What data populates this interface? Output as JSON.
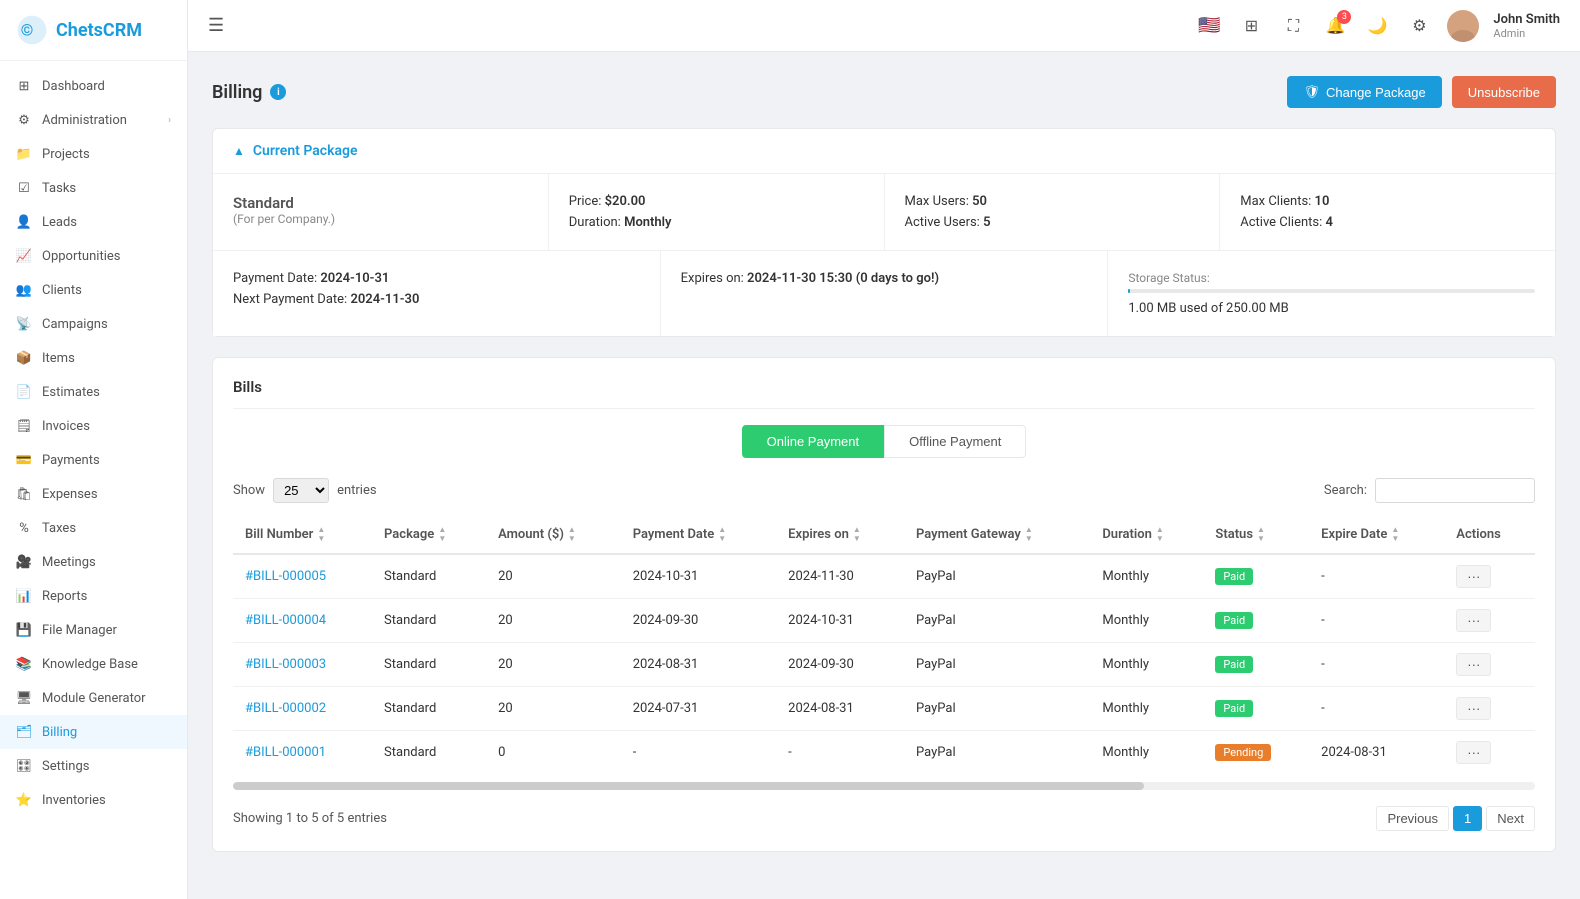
{
  "sidebar": {
    "logo_text": "ChetsCRM",
    "items": [
      {
        "id": "dashboard",
        "label": "Dashboard",
        "icon": "grid",
        "active": false,
        "has_arrow": false
      },
      {
        "id": "administration",
        "label": "Administration",
        "icon": "settings",
        "active": false,
        "has_arrow": true
      },
      {
        "id": "projects",
        "label": "Projects",
        "icon": "folder",
        "active": false,
        "has_arrow": false
      },
      {
        "id": "tasks",
        "label": "Tasks",
        "icon": "check-square",
        "active": false,
        "has_arrow": false
      },
      {
        "id": "leads",
        "label": "Leads",
        "icon": "user-plus",
        "active": false,
        "has_arrow": false
      },
      {
        "id": "opportunities",
        "label": "Opportunities",
        "icon": "trending-up",
        "active": false,
        "has_arrow": false
      },
      {
        "id": "clients",
        "label": "Clients",
        "icon": "users",
        "active": false,
        "has_arrow": false
      },
      {
        "id": "campaigns",
        "label": "Campaigns",
        "icon": "radio",
        "active": false,
        "has_arrow": false
      },
      {
        "id": "items",
        "label": "Items",
        "icon": "package",
        "active": false,
        "has_arrow": false
      },
      {
        "id": "estimates",
        "label": "Estimates",
        "icon": "file-text",
        "active": false,
        "has_arrow": false
      },
      {
        "id": "invoices",
        "label": "Invoices",
        "icon": "file",
        "active": false,
        "has_arrow": false
      },
      {
        "id": "payments",
        "label": "Payments",
        "icon": "credit-card",
        "active": false,
        "has_arrow": false
      },
      {
        "id": "expenses",
        "label": "Expenses",
        "icon": "shopping-bag",
        "active": false,
        "has_arrow": false
      },
      {
        "id": "taxes",
        "label": "Taxes",
        "icon": "percent",
        "active": false,
        "has_arrow": false
      },
      {
        "id": "meetings",
        "label": "Meetings",
        "icon": "video",
        "active": false,
        "has_arrow": false
      },
      {
        "id": "reports",
        "label": "Reports",
        "icon": "bar-chart",
        "active": false,
        "has_arrow": false
      },
      {
        "id": "file-manager",
        "label": "File Manager",
        "icon": "hard-drive",
        "active": false,
        "has_arrow": false
      },
      {
        "id": "knowledge-base",
        "label": "Knowledge Base",
        "icon": "book",
        "active": false,
        "has_arrow": false
      },
      {
        "id": "module-generator",
        "label": "Module Generator",
        "icon": "cpu",
        "active": false,
        "has_arrow": false
      },
      {
        "id": "billing",
        "label": "Billing",
        "icon": "file-text",
        "active": true,
        "has_arrow": false
      },
      {
        "id": "settings",
        "label": "Settings",
        "icon": "sliders",
        "active": false,
        "has_arrow": false
      },
      {
        "id": "inventories",
        "label": "Inventories",
        "icon": "star",
        "active": false,
        "has_arrow": false
      }
    ]
  },
  "header": {
    "hamburger": "☰",
    "flag": "🇺🇸",
    "notification_count": "3",
    "user_name": "John Smith",
    "user_role": "Admin"
  },
  "page": {
    "title": "Billing",
    "change_package_label": "Change Package",
    "unsubscribe_label": "Unsubscribe"
  },
  "current_package": {
    "section_title": "Current Package",
    "package_name": "Standard",
    "package_sub": "(For per Company.)",
    "price_label": "Price:",
    "price_value": "$20.00",
    "duration_label": "Duration:",
    "duration_value": "Monthly",
    "max_users_label": "Max Users:",
    "max_users_value": "50",
    "active_users_label": "Active Users:",
    "active_users_value": "5",
    "max_clients_label": "Max Clients:",
    "max_clients_value": "10",
    "active_clients_label": "Active Clients:",
    "active_clients_value": "4",
    "payment_date_label": "Payment Date:",
    "payment_date_value": "2024-10-31",
    "next_payment_label": "Next Payment Date:",
    "next_payment_value": "2024-11-30",
    "expires_label": "Expires on:",
    "expires_value": "2024-11-30 15:30 (0 days to go!)",
    "storage_label": "Storage Status:",
    "storage_used": "1.00 MB used of 250.00 MB",
    "storage_percent": 0.4
  },
  "bills": {
    "title": "Bills",
    "online_payment_label": "Online Payment",
    "offline_payment_label": "Offline Payment",
    "active_tab": "online",
    "show_label": "Show",
    "show_value": "25",
    "entries_label": "entries",
    "search_label": "Search:",
    "search_value": "",
    "columns": [
      "Bill Number",
      "Package",
      "Amount ($)",
      "Payment Date",
      "Expires on",
      "Payment Gateway",
      "Duration",
      "Status",
      "Expire Date",
      "Actions"
    ],
    "rows": [
      {
        "bill_number": "#BILL-000005",
        "package": "Standard",
        "amount": "20",
        "payment_date": "2024-10-31",
        "expires_on": "2024-11-30",
        "gateway": "PayPal",
        "duration": "Monthly",
        "status": "Paid",
        "expire_date": "-",
        "status_class": "paid"
      },
      {
        "bill_number": "#BILL-000004",
        "package": "Standard",
        "amount": "20",
        "payment_date": "2024-09-30",
        "expires_on": "2024-10-31",
        "gateway": "PayPal",
        "duration": "Monthly",
        "status": "Paid",
        "expire_date": "-",
        "status_class": "paid"
      },
      {
        "bill_number": "#BILL-000003",
        "package": "Standard",
        "amount": "20",
        "payment_date": "2024-08-31",
        "expires_on": "2024-09-30",
        "gateway": "PayPal",
        "duration": "Monthly",
        "status": "Paid",
        "expire_date": "-",
        "status_class": "paid"
      },
      {
        "bill_number": "#BILL-000002",
        "package": "Standard",
        "amount": "20",
        "payment_date": "2024-07-31",
        "expires_on": "2024-08-31",
        "gateway": "PayPal",
        "duration": "Monthly",
        "status": "Paid",
        "expire_date": "-",
        "status_class": "paid"
      },
      {
        "bill_number": "#BILL-000001",
        "package": "Standard",
        "amount": "0",
        "payment_date": "-",
        "expires_on": "-",
        "gateway": "PayPal",
        "duration": "Monthly",
        "status": "Pending",
        "expire_date": "2024-08-31",
        "status_class": "pending"
      }
    ],
    "showing_text": "Showing 1 to 5 of 5 entries",
    "prev_label": "Previous",
    "next_label": "Next",
    "current_page": "1"
  }
}
